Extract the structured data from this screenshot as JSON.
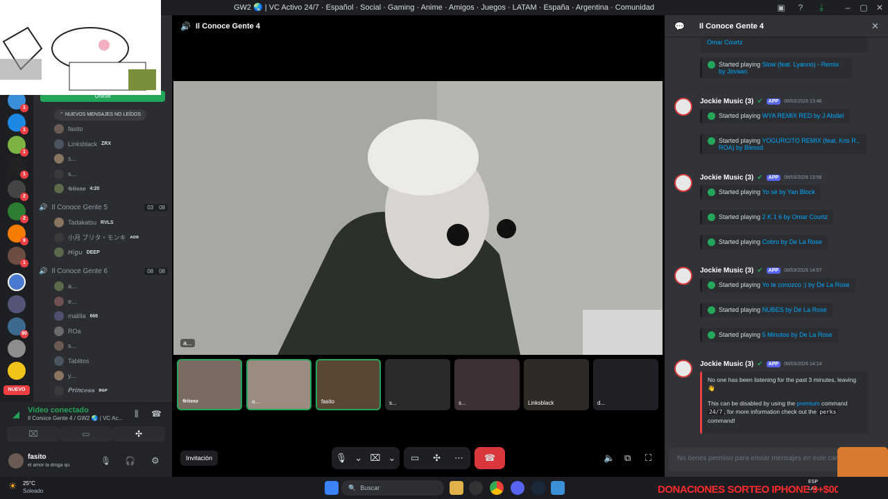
{
  "window": {
    "title": "GW2 🌏 | VC Activo 24/7 · Español · Social · Gaming · Anime · Amigos · Juegos · LATAM · España · Argentina · Comunidad"
  },
  "overlay": {
    "join_label": "Unirse"
  },
  "servers": {
    "badges": [
      "1",
      "1",
      "1",
      "1",
      "2",
      "2",
      "9",
      "1",
      "1",
      "90"
    ],
    "nuevo_label": "NUEVO"
  },
  "channels": {
    "new_messages_label": "NUEVOS MENSAJES NO LEÍDOS",
    "users_top": [
      {
        "name": "fasito",
        "tag": ""
      },
      {
        "name": "Linksblack",
        "tag": "ZRX"
      },
      {
        "name": "s...",
        "tag": ""
      },
      {
        "name": "s...",
        "tag": ""
      },
      {
        "name": "𝕲𝖎𝖙𝖆𝖓𝖔",
        "tag": "4:20"
      }
    ],
    "channel5": {
      "name": "Il Conoce Gente 5",
      "count_a": "03",
      "count_b": "08"
    },
    "users_5": [
      {
        "name": "Tadakatsu",
        "tag": "RVLS"
      },
      {
        "name": "小月 ブリタ・モンキ",
        "tag": "ᴀᴏᴙ"
      },
      {
        "name": "𝘏𝘪𝘨𝘶",
        "tag": "DEEP"
      }
    ],
    "channel6": {
      "name": "Il Conoce Gente 6",
      "count_a": "08",
      "count_b": "08"
    },
    "users_6": [
      {
        "name": "a...",
        "tag": ""
      },
      {
        "name": "e...",
        "tag": ""
      },
      {
        "name": "malilla",
        "tag": "666"
      },
      {
        "name": "ROa",
        "tag": ""
      },
      {
        "name": "s...",
        "tag": ""
      },
      {
        "name": "Tablitos",
        "tag": ""
      },
      {
        "name": "y...",
        "tag": ""
      },
      {
        "name": "𝑷𝒓𝒊𝒏𝒄𝒆𝒔𝒔",
        "tag": "ʙɢᴘ"
      }
    ]
  },
  "voice_panel": {
    "status": "Video conectado",
    "location": "Il Conoce Gente 4 / GW2 🌏 | VC Ac...",
    "username": "fasito",
    "user_status": "el amor la droga qu"
  },
  "stage": {
    "channel_name": "Il Conoce Gente 4",
    "main_label": "a...",
    "invite_label": "Invitación",
    "thumbs": [
      {
        "label": "𝕲𝖎𝖙𝖆𝖓𝖔",
        "bg": "#7a6b62"
      },
      {
        "label": "a...",
        "bg": "#9a8c80"
      },
      {
        "label": "fasito",
        "bg": "#5a4634"
      },
      {
        "label": "s...",
        "bg": "#2a2a2a"
      },
      {
        "label": "s...",
        "bg": "#3c2f36"
      },
      {
        "label": "Linksblack",
        "bg": "#2e2a26"
      },
      {
        "label": "d...",
        "bg": "#1f2126"
      }
    ]
  },
  "chat": {
    "header_title": "Il Conoce Gente 4",
    "input_placeholder": "No tienes permiso para enviar mensajes en este canal.",
    "top_partial_song": "Omar Courtz",
    "top_msg": {
      "prefix": "Started playing",
      "song": "Slow (feat. Lyanno) - Remix by Jovaan"
    },
    "bot_name": "Jockie Music (3)",
    "app_tag": "APP",
    "groups": [
      {
        "time": "08/03/2026 13:46",
        "items": [
          "WYA REMIX RED by J Abdiel",
          "YOGURCITO REMIX (feat. Kris R., ROA) by Blessd"
        ]
      },
      {
        "time": "08/03/2026 13:58",
        "items": [
          "Yo sé by Yan Block",
          "2 K 1 6 by Omar Courtz",
          "Cobro by De La Rose"
        ]
      },
      {
        "time": "08/03/2026 14:07",
        "items": [
          "Yo te conozco :) by De La Rose",
          "NUBES by De La Rose",
          "5 Minutos by De La Rose"
        ]
      }
    ],
    "prefix": "Started playing",
    "last": {
      "time": "08/03/2026 14:14",
      "line1": "No one has been listening for the past 3 minutes, leaving 👋",
      "line2a": "This can be disabled by using the",
      "premium": "premium",
      "line2b": "command",
      "code": "24/7",
      "line3": ", for more information check out the",
      "perks": "perks",
      "line4": "command!"
    }
  },
  "taskbar": {
    "weather_temp": "25°C",
    "weather_desc": "Soleado",
    "search_placeholder": "Buscar",
    "lang": "ESP",
    "lang2": "LAA",
    "donation_banner": "DONACIONES SORTEO IPHONE 9+$00"
  }
}
